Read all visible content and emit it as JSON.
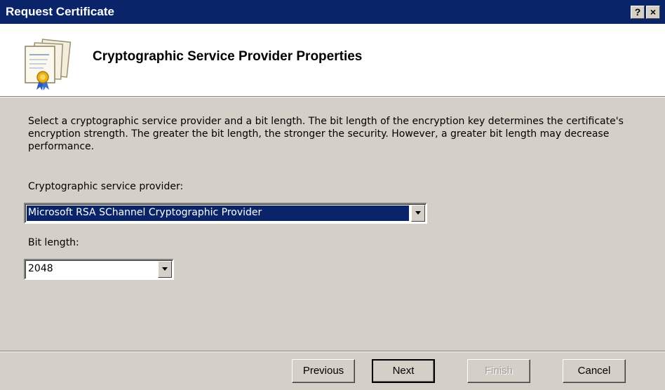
{
  "window": {
    "title": "Request Certificate",
    "help_label": "?",
    "close_label": "×"
  },
  "header": {
    "title": "Cryptographic Service Provider Properties",
    "icon": "certificate-icon"
  },
  "description": "Select a cryptographic service provider and a bit length. The bit length of the encryption key determines the certificate's encryption strength. The greater the bit length, the stronger the security. However, a greater bit length may decrease performance.",
  "provider": {
    "label": "Cryptographic service provider:",
    "value": "Microsoft RSA SChannel Cryptographic Provider"
  },
  "bit_length": {
    "label": "Bit length:",
    "value": "2048"
  },
  "buttons": {
    "previous": "Previous",
    "next": "Next",
    "finish": "Finish",
    "cancel": "Cancel"
  },
  "colors": {
    "titlebar": "#0a246a",
    "dialog_bg": "#d4d0c8",
    "selection": "#0a246a"
  }
}
